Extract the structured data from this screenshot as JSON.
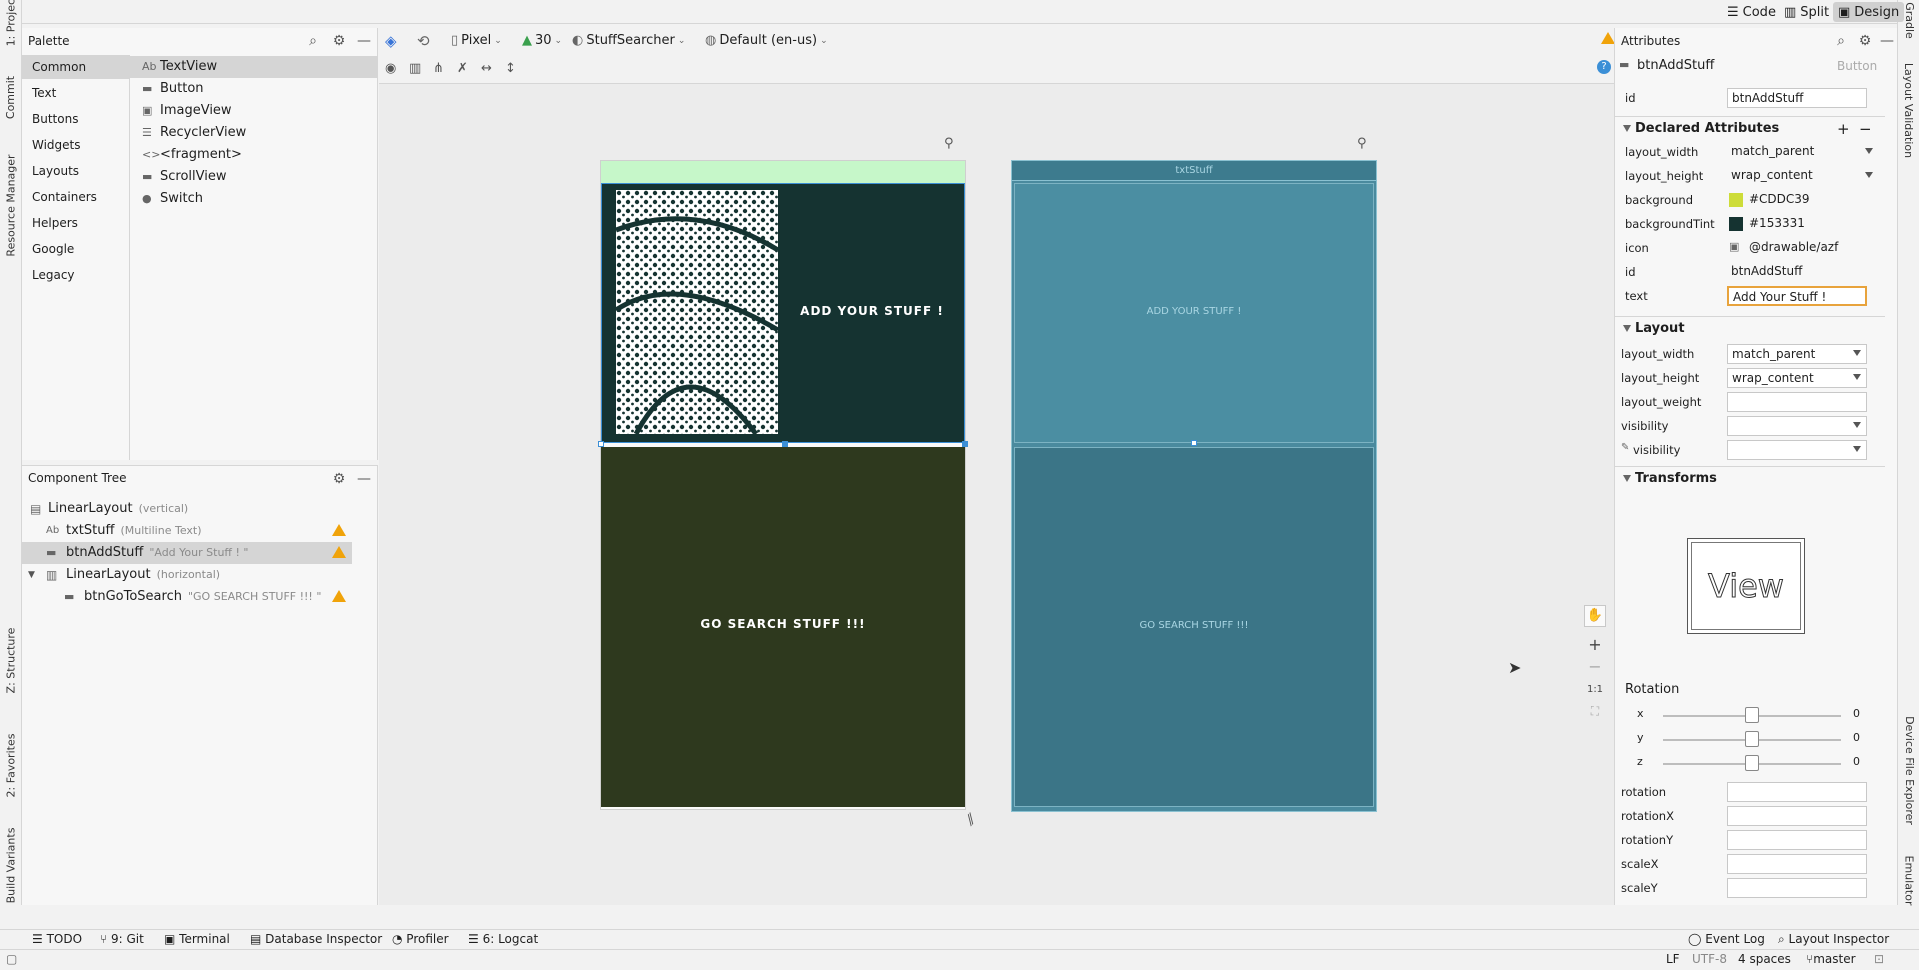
{
  "mode_bar": {
    "code": "Code",
    "split": "Split",
    "design": "Design"
  },
  "left_tabs": [
    "1: Project",
    "Commit",
    "Resource Manager",
    "Z: Structure",
    "2: Favorites",
    "Build Variants"
  ],
  "right_tabs": [
    "Gradle",
    "Layout Validation",
    "Device File Explorer",
    "Emulator"
  ],
  "palette": {
    "title": "Palette",
    "categories": [
      "Common",
      "Text",
      "Buttons",
      "Widgets",
      "Layouts",
      "Containers",
      "Helpers",
      "Google",
      "Legacy"
    ],
    "selected_category": "Common",
    "items": [
      {
        "icon": "Ab",
        "label": "TextView"
      },
      {
        "icon": "▬",
        "label": "Button"
      },
      {
        "icon": "▣",
        "label": "ImageView"
      },
      {
        "icon": "☰",
        "label": "RecyclerView"
      },
      {
        "icon": "<>",
        "label": "<fragment>"
      },
      {
        "icon": "▬",
        "label": "ScrollView"
      },
      {
        "icon": "●",
        "label": "Switch"
      }
    ]
  },
  "component_tree": {
    "title": "Component Tree",
    "rows": [
      {
        "name": "LinearLayout",
        "sub": "(vertical)",
        "warn": false
      },
      {
        "name": "txtStuff",
        "sub": "(Multiline Text)",
        "warn": true
      },
      {
        "name": "btnAddStuff",
        "sub": "\"Add Your Stuff ! \"",
        "warn": true
      },
      {
        "name": "LinearLayout",
        "sub": "(horizontal)",
        "warn": false
      },
      {
        "name": "btnGoToSearch",
        "sub": "\"GO SEARCH STUFF !!! \"",
        "warn": true
      }
    ]
  },
  "design_toolbar": {
    "device": "Pixel",
    "api": "30",
    "theme": "StuffSearcher",
    "locale": "Default (en-us)"
  },
  "preview": {
    "add_button": "ADD YOUR STUFF !",
    "search_button": "GO SEARCH STUFF !!!",
    "blueprint_header": "txtStuff",
    "blueprint_add": "ADD YOUR STUFF !",
    "blueprint_search": "GO SEARCH STUFF !!!"
  },
  "zoom_controls": {
    "one_to_one": "1:1"
  },
  "attributes": {
    "title": "Attributes",
    "selected_id": "btnAddStuff",
    "selected_type": "Button",
    "id_label": "id",
    "id_value": "btnAddStuff",
    "declared_title": "Declared Attributes",
    "declared": [
      {
        "name": "layout_width",
        "value": "match_parent",
        "dropdown": true
      },
      {
        "name": "layout_height",
        "value": "wrap_content",
        "dropdown": true
      },
      {
        "name": "background",
        "value": "#CDDC39",
        "swatch": "#CDDC39"
      },
      {
        "name": "backgroundTint",
        "value": "#153331",
        "swatch": "#153331"
      },
      {
        "name": "icon",
        "value": "@drawable/azf"
      },
      {
        "name": "id",
        "value": "btnAddStuff"
      },
      {
        "name": "text",
        "value": "Add Your Stuff !",
        "editing": true
      }
    ],
    "layout_title": "Layout",
    "layout": [
      {
        "name": "layout_width",
        "value": "match_parent",
        "dropdown": true
      },
      {
        "name": "layout_height",
        "value": "wrap_content",
        "dropdown": true
      },
      {
        "name": "layout_weight",
        "value": ""
      },
      {
        "name": "visibility",
        "value": "",
        "dropdown": true
      },
      {
        "name": "visibility",
        "value": "",
        "dropdown": true
      }
    ],
    "transforms_title": "Transforms",
    "view_preview_label": "View",
    "rotation_title": "Rotation",
    "rotation_axes": [
      {
        "axis": "x",
        "value": "0"
      },
      {
        "axis": "y",
        "value": "0"
      },
      {
        "axis": "z",
        "value": "0"
      }
    ],
    "transform_fields": [
      "rotation",
      "rotationX",
      "rotationY",
      "scaleX",
      "scaleY"
    ]
  },
  "bottom_tools": [
    "TODO",
    "9: Git",
    "Terminal",
    "Database Inspector",
    "Profiler",
    "6: Logcat"
  ],
  "bottom_right_tools": [
    "Event Log",
    "Layout Inspector"
  ],
  "status_bar": {
    "line_sep": "LF",
    "encoding": "UTF-8",
    "indent": "4 spaces",
    "branch": "master"
  },
  "colors": {
    "preview_add_bg": "#153331",
    "preview_search_bg": "#2e391e",
    "blueprint_bg": "#4a8a9e",
    "status_bar_green": "#c6f7c9",
    "accent_blue": "#3874d8",
    "warn": "#f0a30a"
  }
}
